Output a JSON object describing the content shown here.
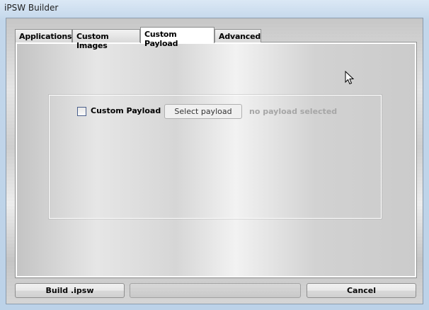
{
  "window": {
    "title": "iPSW Builder"
  },
  "tabs": [
    {
      "label": "Applications"
    },
    {
      "label": "Custom Images"
    },
    {
      "label": "Custom Payload",
      "active": true
    },
    {
      "label": "Advanced"
    }
  ],
  "payload": {
    "checkbox_label": "Custom Payload",
    "checked": false,
    "select_button": "Select payload",
    "status": "no payload selected"
  },
  "footer": {
    "build_label": "Build .ipsw",
    "cancel_label": "Cancel",
    "progress": 0
  }
}
